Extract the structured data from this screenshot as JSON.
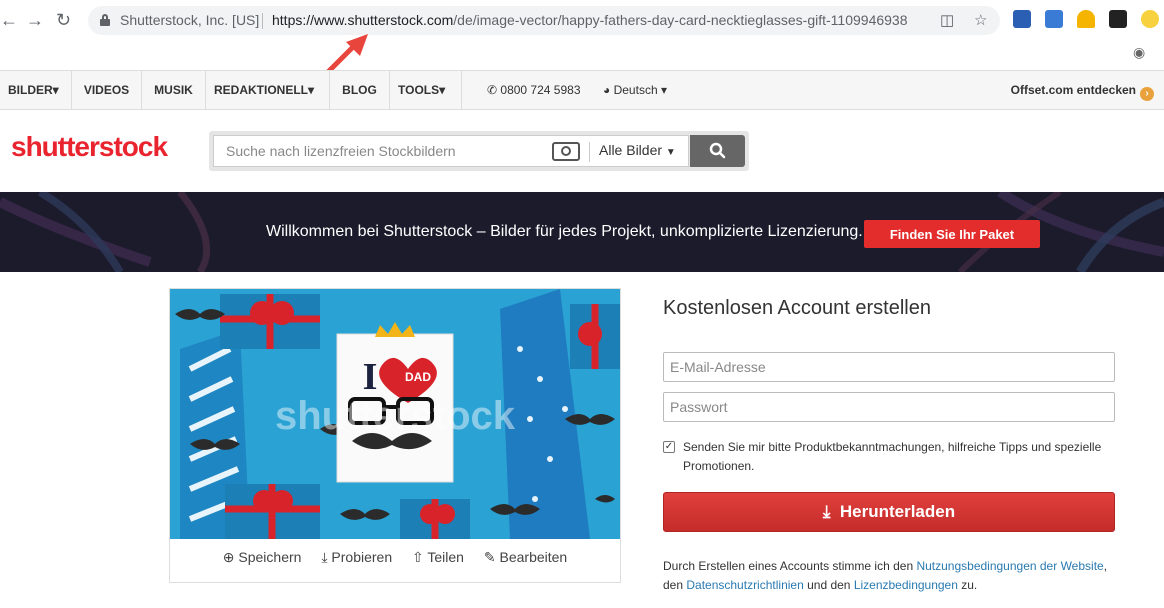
{
  "browser": {
    "site_identity": "Shutterstock, Inc. [US]",
    "url_host": "https://www.shutterstock.com",
    "url_path": "/de/image-vector/happy-fathers-day-card-necktieglasses-gift-1109946938"
  },
  "nav": {
    "items": [
      {
        "label": "BILDER▾"
      },
      {
        "label": "VIDEOS"
      },
      {
        "label": "MUSIK"
      },
      {
        "label": "REDAKTIONELL▾"
      },
      {
        "label": "BLOG"
      },
      {
        "label": "TOOLS▾"
      }
    ],
    "phone": "0800 724 5983",
    "language": "Deutsch ▾",
    "offset_link": "Offset.com entdecken"
  },
  "header": {
    "logo": "shutterstock",
    "search_placeholder": "Suche nach lizenzfreien Stockbildern",
    "filter_label": "Alle Bilder"
  },
  "banner": {
    "text": "Willkommen bei Shutterstock – Bilder für jedes Projekt, unkomplizierte Lizenzierung.",
    "button": "Finden Sie Ihr Paket"
  },
  "preview": {
    "card_letter": "I",
    "card_heart_text": "DAD",
    "watermark": "shutterstock",
    "actions": [
      {
        "label": "Speichern"
      },
      {
        "label": "Probieren"
      },
      {
        "label": "Teilen"
      },
      {
        "label": "Bearbeiten"
      }
    ]
  },
  "form": {
    "title": "Kostenlosen Account erstellen",
    "email_placeholder": "E-Mail-Adresse",
    "password_placeholder": "Passwort",
    "checkbox_label": "Senden Sie mir bitte Produktbekanntmachungen, hilfreiche Tipps und spezielle Promotionen.",
    "download_button": "Herunterladen",
    "legal_pre": "Durch Erstellen eines Accounts stimme ich den ",
    "legal_link1": "Nutzungsbedingungen der Website",
    "legal_mid1": ", den ",
    "legal_link2": "Datenschutzrichtlinien",
    "legal_mid2": " und den ",
    "legal_link3": "Lizenzbedingungen",
    "legal_post": " zu."
  },
  "colors": {
    "brand_red": "#e9242f",
    "button_red": "#e32d2d",
    "link_blue": "#2a7ab0",
    "banner_bg": "#1c1b2c",
    "preview_bg": "#2aa3d4"
  }
}
